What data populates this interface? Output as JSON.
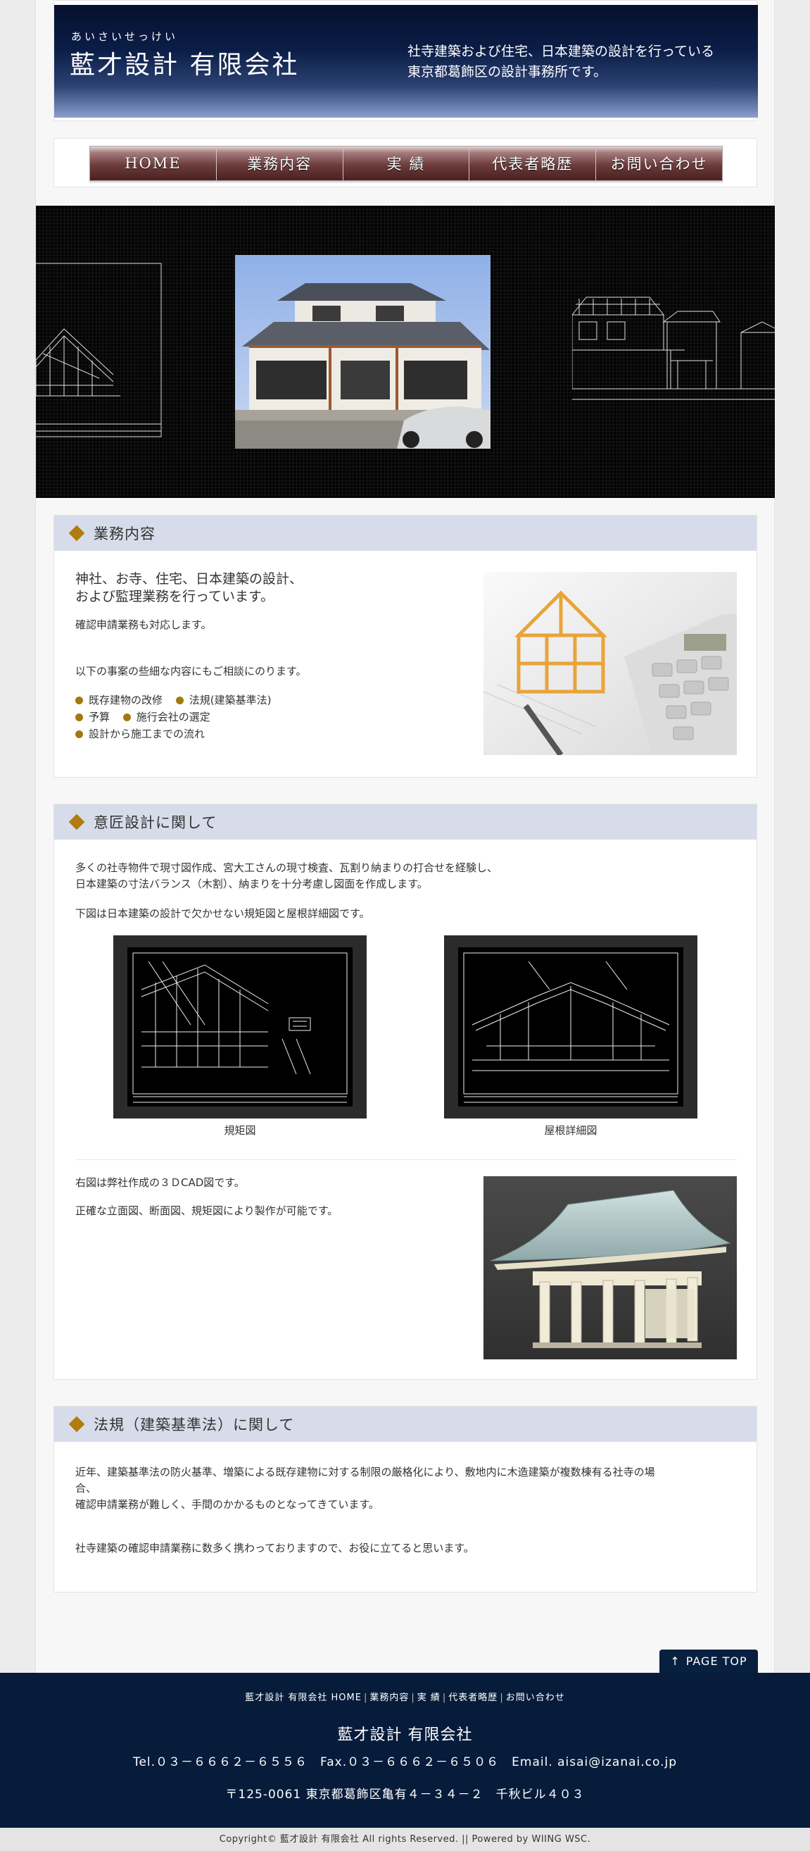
{
  "header": {
    "kana": "あいさいせっけい",
    "company": "藍才設計 有限会社",
    "tagline_line1": "社寺建築および住宅、日本建築の設計を行っている",
    "tagline_line2": "東京都葛飾区の設計事務所です。"
  },
  "nav": {
    "items": [
      {
        "label": "HOME"
      },
      {
        "label": "業務内容"
      },
      {
        "label": "実 績"
      },
      {
        "label": "代表者略歴"
      },
      {
        "label": "お問い合わせ"
      }
    ]
  },
  "section1": {
    "title": "業務内容",
    "lead_line1": "神社、お寺、住宅、日本建築の設計、",
    "lead_line2": "および監理業務を行っています。",
    "p1": "確認申請業務も対応します。",
    "p2": "以下の事案の些細な内容にもご相談にのります。",
    "bullets": [
      "既存建物の改修",
      "法規(建築基準法)",
      "予算",
      "施行会社の選定",
      "設計から施工までの流れ"
    ]
  },
  "section2": {
    "title": "意匠設計に関して",
    "p1_line1": "多くの社寺物件で現寸図作成、宮大工さんの現寸検査、瓦割り納まりの打合せを経験し、",
    "p1_line2": "日本建築の寸法バランス（木割）、納まりを十分考慮し図面を作成します。",
    "p2": "下図は日本建築の設計で欠かせない規矩図と屋根詳細図です。",
    "caption1": "規矩図",
    "caption2": "屋根詳細図",
    "p3": "右図は弊社作成の３ＤCAD図です。",
    "p4": "正確な立面図、断面図、規矩図により製作が可能です。"
  },
  "section3": {
    "title": "法規（建築基準法）に関して",
    "p1_line1": "近年、建築基準法の防火基準、増築による既存建物に対する制限の厳格化により、敷地内に木造建築が複数棟有る社寺の場",
    "p1_line2": "合、",
    "p1_line3": "確認申請業務が難しく、手間のかかるものとなってきています。",
    "p2": "社寺建築の確認申請業務に数多く携わっておりますので、お役に立てると思います。"
  },
  "page_top": {
    "arrow": "↑",
    "label": "PAGE TOP"
  },
  "footer": {
    "links": [
      "藍才設計 有限会社 HOME",
      "業務内容",
      "実 績",
      "代表者略歴",
      "お問い合わせ"
    ],
    "separator": "|",
    "company": "藍才設計 有限会社",
    "contact": "Tel.０３－６６６２－６５５６　Fax.０３－６６６２－６５０６　Email. aisai@izanai.co.jp",
    "address": "〒125-0061 東京都葛飾区亀有４－３４－２　千秋ビル４０３",
    "copyright": "Copyright© 藍才設計 有限会社 All rights Reserved. || Powered by WIING WSC."
  },
  "colors": {
    "header_dark": "#05102c",
    "nav_maroon": "#6d3c3c",
    "section_head_bg": "#d7dcea",
    "bullet_gold": "#a2780f",
    "footer_navy": "#071c3b"
  }
}
